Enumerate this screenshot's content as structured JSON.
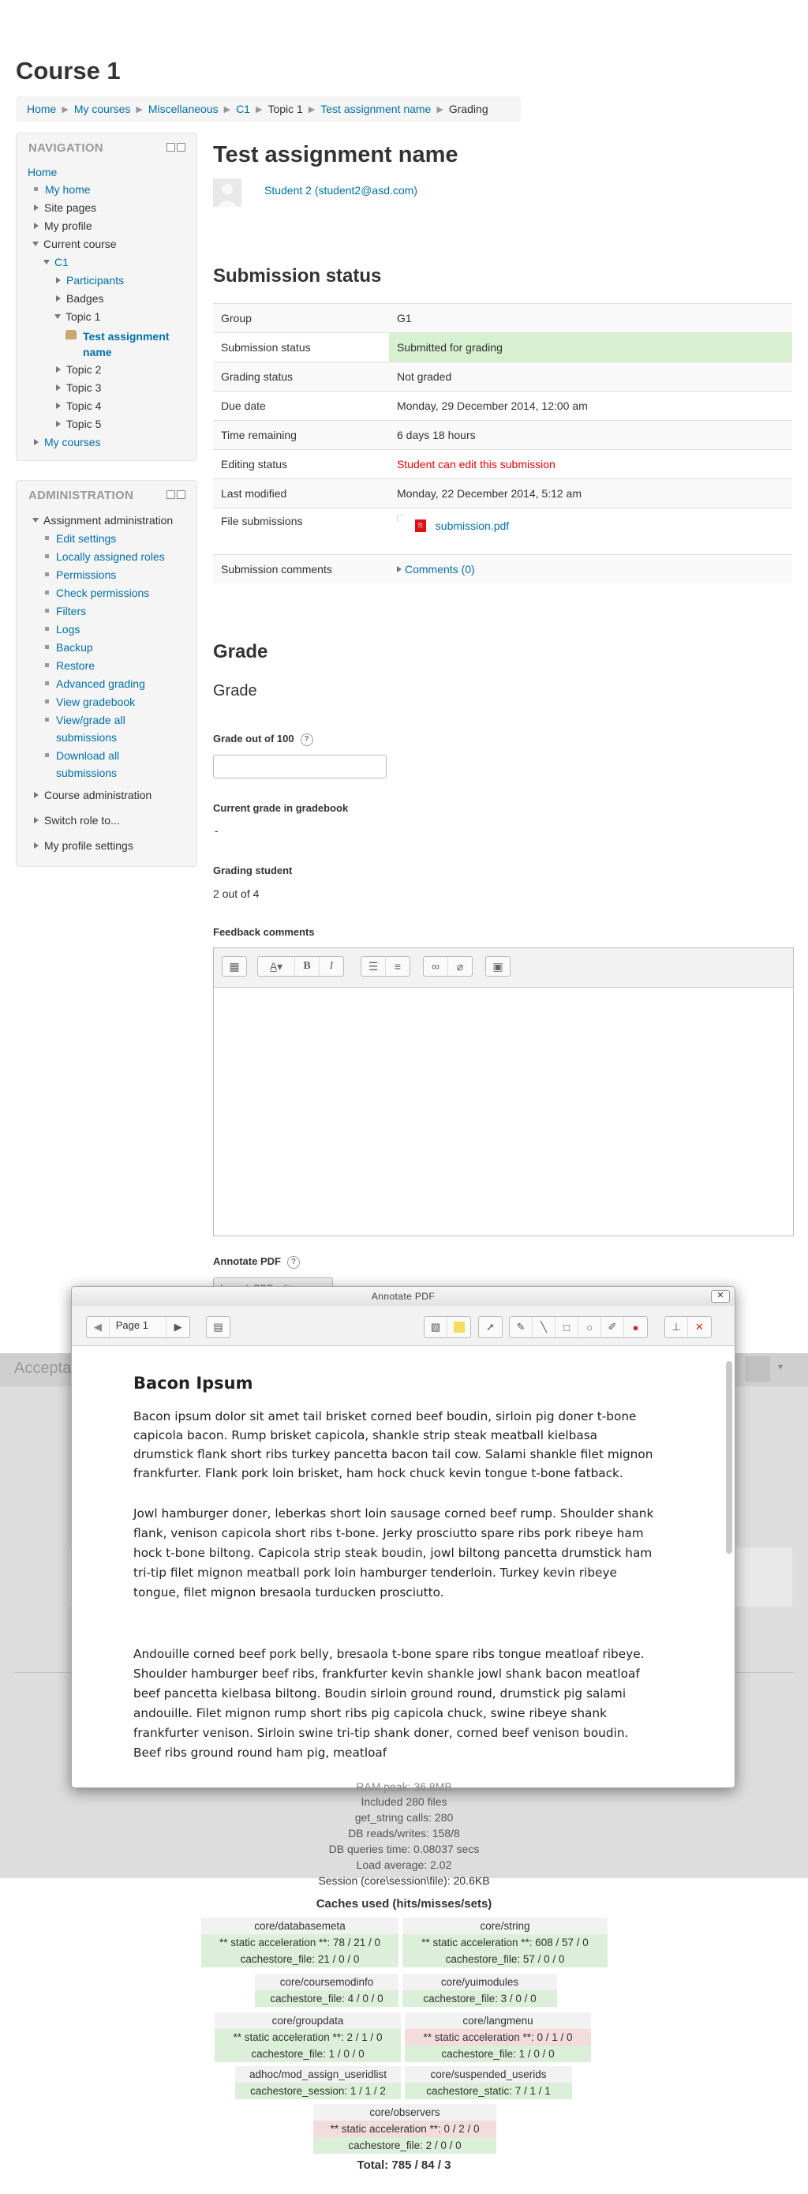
{
  "course_title": "Course 1",
  "breadcrumb": [
    "Home",
    "My courses",
    "Miscellaneous",
    "C1",
    "Topic 1",
    "Test assignment name",
    "Grading"
  ],
  "navigation": {
    "title": "NAVIGATION",
    "home": "Home",
    "my_home": "My home",
    "site_pages": "Site pages",
    "my_profile": "My profile",
    "current_course": "Current course",
    "c1": "C1",
    "participants": "Participants",
    "badges": "Badges",
    "topic1": "Topic 1",
    "assignment_line1": "Test assignment",
    "assignment_line2": "name",
    "topic2": "Topic 2",
    "topic3": "Topic 3",
    "topic4": "Topic 4",
    "topic5": "Topic 5",
    "my_courses": "My courses"
  },
  "administration": {
    "title": "ADMINISTRATION",
    "assignment_admin": "Assignment administration",
    "items": [
      "Edit settings",
      "Locally assigned roles",
      "Permissions",
      "Check permissions",
      "Filters",
      "Logs",
      "Backup",
      "Restore",
      "Advanced grading",
      "View gradebook"
    ],
    "view_grade_1": "View/grade all",
    "view_grade_2": "submissions",
    "download_1": "Download all",
    "download_2": "submissions",
    "course_admin": "Course administration",
    "switch_role": "Switch role to...",
    "profile_settings": "My profile settings"
  },
  "main": {
    "assignment_title": "Test assignment name",
    "student": "Student 2 (student2@asd.com)",
    "submission_heading": "Submission status",
    "status_rows": [
      {
        "label": "Group",
        "value": "G1"
      },
      {
        "label": "Submission status",
        "value": "Submitted for grading"
      },
      {
        "label": "Grading status",
        "value": "Not graded"
      },
      {
        "label": "Due date",
        "value": "Monday, 29 December 2014, 12:00 am"
      },
      {
        "label": "Time remaining",
        "value": "6 days 18 hours"
      },
      {
        "label": "Editing status",
        "value": "Student can edit this submission"
      },
      {
        "label": "Last modified",
        "value": "Monday, 22 December 2014, 5:12 am"
      },
      {
        "label": "File submissions",
        "value": "submission.pdf"
      },
      {
        "label": "Submission comments",
        "value": "Comments (0)"
      }
    ],
    "grade_heading": "Grade",
    "grade_subheading": "Grade",
    "grade_out_of": "Grade out of 100",
    "current_grade_label": "Current grade in gradebook",
    "current_grade_value": "-",
    "grading_student_label": "Grading student",
    "grading_student_value": "2 out of 4",
    "feedback_label": "Feedback comments",
    "annotate_label": "Annotate PDF",
    "annotate_button": "Launch PDF editor..."
  },
  "behind": {
    "accept_text": "Accepta"
  },
  "modal": {
    "title": "Annotate PDF",
    "close": "✕",
    "page_select": "Page 1",
    "pdf_heading": "Bacon Ipsum",
    "para1": "Bacon ipsum dolor sit amet tail brisket corned beef boudin, sirloin pig doner t-bone capicola bacon. Rump brisket capicola, shankle strip steak meatball kielbasa drumstick flank short ribs turkey pancetta bacon tail cow. Salami shankle filet mignon frankfurter. Flank pork loin brisket, ham hock chuck kevin tongue t-bone fatback.",
    "para2": "Jowl hamburger doner, leberkas short loin sausage corned beef rump. Shoulder shank flank, venison capicola short ribs t-bone. Jerky prosciutto spare ribs pork ribeye ham hock t-bone biltong. Capicola strip steak boudin, jowl biltong pancetta drumstick ham tri-tip filet mignon meatball pork loin hamburger tenderloin. Turkey kevin ribeye tongue, filet mignon bresaola turducken prosciutto.",
    "para3": "Andouille corned beef pork belly, bresaola t-bone spare ribs tongue meatloaf ribeye. Shoulder hamburger beef ribs, frankfurter kevin shankle jowl shank bacon meatloaf beef pancetta kielbasa biltong. Boudin sirloin ground round, drumstick pig salami andouille. Filet mignon rump short ribs pig capicola chuck, swine ribeye shank frankfurter venison. Sirloin swine tri-tip shank doner, corned beef venison boudin. Beef ribs ground round ham pig, meatloaf"
  },
  "perf": {
    "ram_peak": "RAM peak: 36.8MB",
    "included": "Included 280 files",
    "get_string": "get_string calls: 280",
    "db_rw": "DB reads/writes: 158/8",
    "db_time": "DB queries time: 0.08037 secs",
    "load": "Load average: 2.02",
    "session": "Session (core\\session\\file): 20.6KB"
  },
  "caches": {
    "title": "Caches used (hits/misses/sets)",
    "databasemeta": {
      "name": "core/databasemeta",
      "static": "** static acceleration **: 78 / 21 / 0",
      "file": "cachestore_file: 21 / 0 / 0"
    },
    "string": {
      "name": "core/string",
      "static": "** static acceleration **: 608 / 57 / 0",
      "file": "cachestore_file: 57 / 0 / 0"
    },
    "coursemodinfo": {
      "name": "core/coursemodinfo",
      "file": "cachestore_file: 4 / 0 / 0"
    },
    "yuimodules": {
      "name": "core/yuimodules",
      "file": "cachestore_file: 3 / 0 / 0"
    },
    "groupdata": {
      "name": "core/groupdata",
      "static": "** static acceleration **: 2 / 1 / 0",
      "file": "cachestore_file: 1 / 0 / 0"
    },
    "langmenu": {
      "name": "core/langmenu",
      "static": "** static acceleration **: 0 / 1 / 0",
      "file": "cachestore_file: 1 / 0 / 0"
    },
    "userid": {
      "name": "adhoc/mod_assign_useridlist",
      "file": "cachestore_session: 1 / 1 / 2"
    },
    "suspended": {
      "name": "core/suspended_userids",
      "file": "cachestore_static: 7 / 1 / 1"
    },
    "observers": {
      "name": "core/observers",
      "static": "** static acceleration **: 0 / 2 / 0",
      "file": "cachestore_file: 2 / 0 / 0"
    },
    "total": "Total: 785 / 84 / 3"
  }
}
